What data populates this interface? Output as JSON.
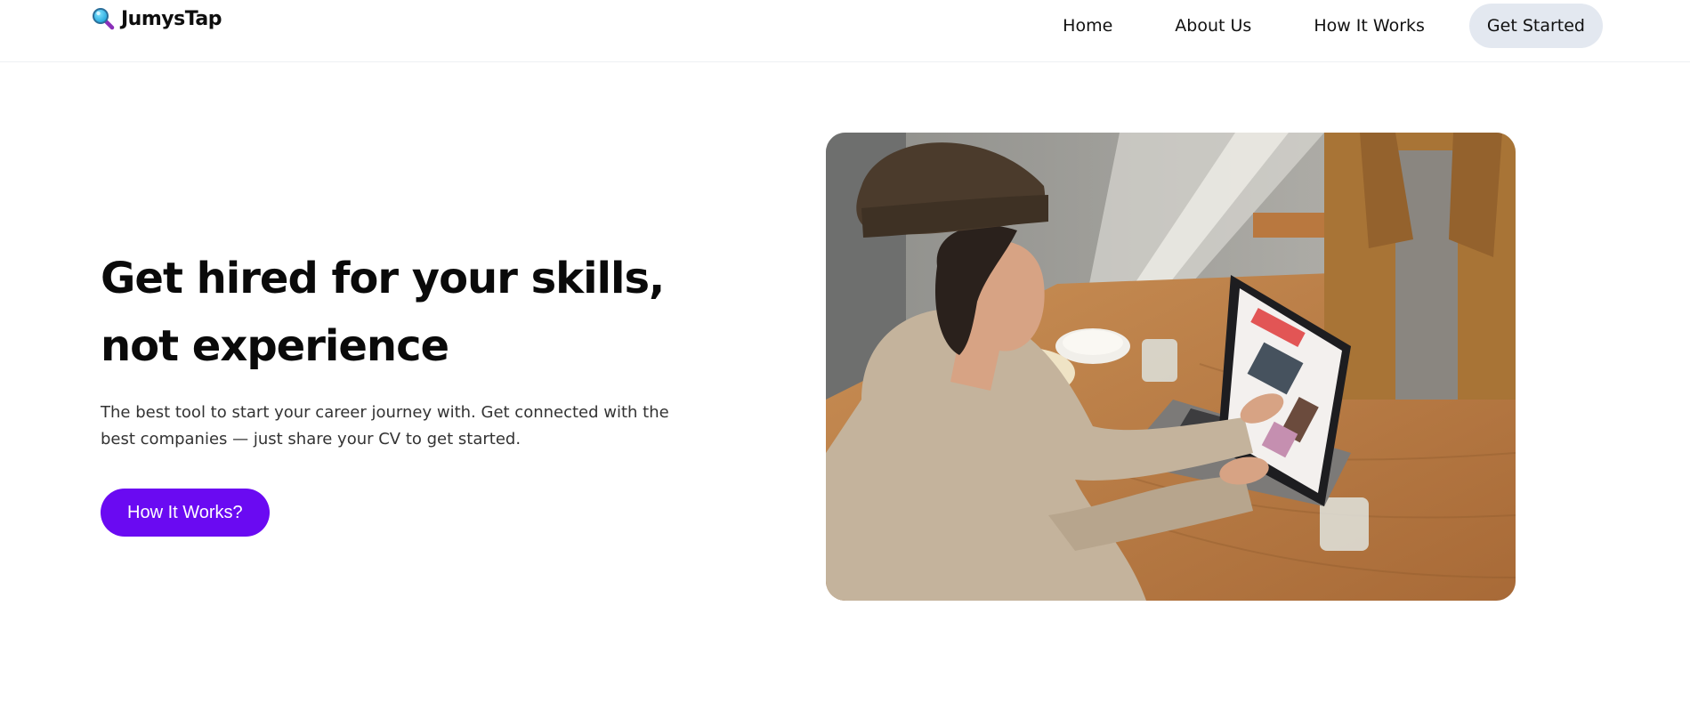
{
  "brand": {
    "name": "JumysTap",
    "icon": "magnifier-icon"
  },
  "nav": {
    "links": [
      "Home",
      "About Us",
      "How It Works"
    ],
    "cta": "Get Started"
  },
  "hero": {
    "title": "Get hired for your skills, not experience",
    "subtitle": "The best tool to start your career journey with. Get connected with the best companies — just share your CV to get started.",
    "button": "How It Works?",
    "image": "photo-woman-using-laptop-at-cafe-table"
  },
  "colors": {
    "accent": "#6a0af2",
    "cta_background": "#e3e8f0",
    "text": "#111111"
  }
}
